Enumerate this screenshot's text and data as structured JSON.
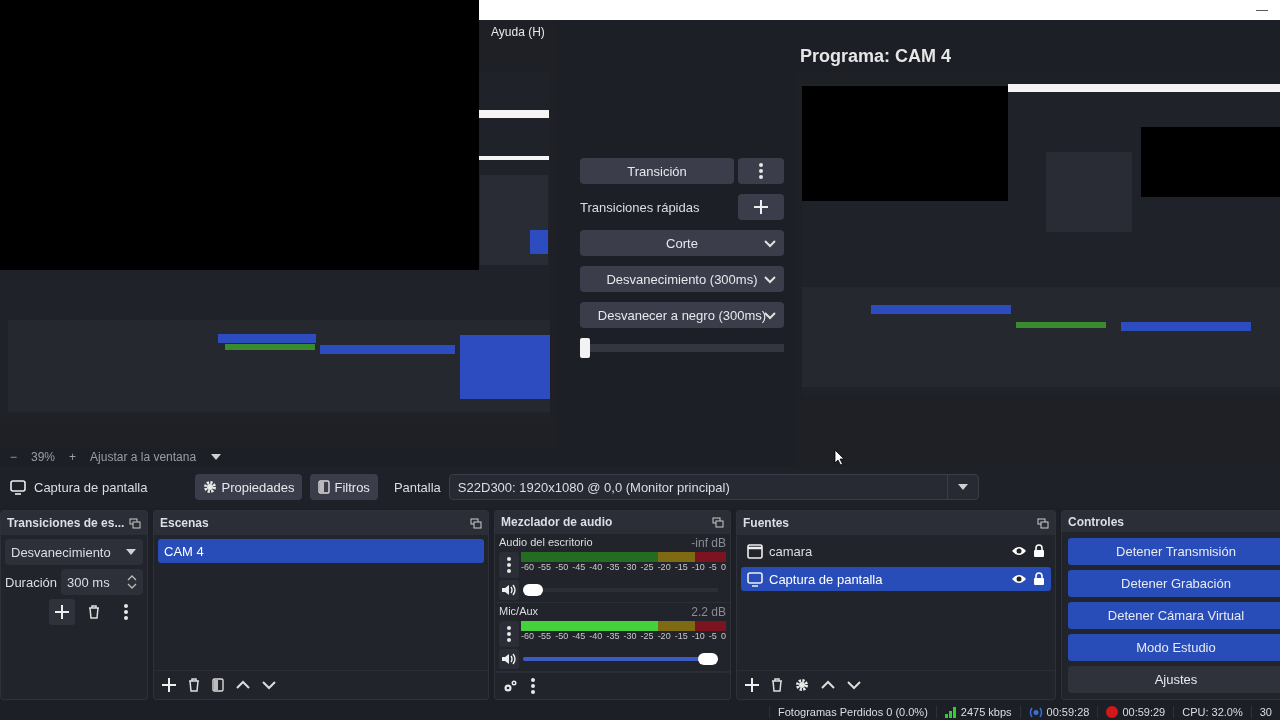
{
  "title_bar": {
    "minimize": "—"
  },
  "menu": [
    {
      "label": "Ayuda (H)"
    }
  ],
  "preview": {
    "kind": "picture",
    "zoom_out": "−",
    "zoom": "39%",
    "zoom_in": "+",
    "scale_mode": "Ajustar a la ventana"
  },
  "transition_panel": {
    "transition_button": "Transición",
    "quick_label": "Transiciones rápidas",
    "quick_transitions": [
      "Corte",
      "Desvanecimiento (300ms)",
      "Desvanecer a negro (300ms)"
    ],
    "tbar": {
      "level": 0
    }
  },
  "program": {
    "title": "Programa: CAM 4",
    "kind": "picture"
  },
  "source_toolbar": {
    "source_name": "Captura de pantalla",
    "properties": "Propiedades",
    "filters": "Filtros",
    "display_label": "Pantalla",
    "display_value": "S22D300: 1920x1080 @ 0,0 (Monitor principal)"
  },
  "transitions_dock": {
    "title": "Transiciones de es...",
    "transition": "Desvanecimiento",
    "duration_label": "Duración",
    "duration": "300 ms"
  },
  "scenes_dock": {
    "title": "Escenas",
    "items": [
      {
        "label": "CAM 4",
        "selected": true
      }
    ]
  },
  "mixer_dock": {
    "title": "Mezclador de audio",
    "channels": [
      {
        "name": "Audio del escritorio",
        "reading": "-inf dB",
        "meter": {
          "level": 0
        },
        "volume": {
          "level": 0
        },
        "scale": [
          "-60",
          "-55",
          "-50",
          "-45",
          "-40",
          "-35",
          "-30",
          "-25",
          "-20",
          "-15",
          "-10",
          "-5",
          "0"
        ]
      },
      {
        "name": "Mic/Aux",
        "reading": "2.2 dB",
        "meter": {
          "level": 0.67
        },
        "volume": {
          "level": 1
        },
        "scale": [
          "-60",
          "-55",
          "-50",
          "-45",
          "-40",
          "-35",
          "-30",
          "-25",
          "-20",
          "-15",
          "-10",
          "-5",
          "0"
        ]
      }
    ]
  },
  "sources_dock": {
    "title": "Fuentes",
    "items": [
      {
        "kind": "window",
        "label": "camara",
        "selected": false,
        "visible": true,
        "locked": true
      },
      {
        "kind": "display",
        "label": "Captura de pantalla",
        "selected": true,
        "visible": true,
        "locked": true
      }
    ]
  },
  "controls_dock": {
    "title": "Controles",
    "buttons": [
      {
        "label": "Detener Transmisión",
        "active": true
      },
      {
        "label": "Detener Grabación",
        "active": true
      },
      {
        "label": "Detener Cámara Virtual",
        "active": true
      },
      {
        "label": "Modo Estudio",
        "active": true
      },
      {
        "label": "Ajustes",
        "active": false
      }
    ]
  },
  "status_bar": {
    "dropped_frames": "Fotogramas Perdidos 0 (0.0%)",
    "bitrate": "2475 kbps",
    "stream_time": "00:59:28",
    "record_time": "00:59:29",
    "cpu": "CPU: 32.0%",
    "fps": "30"
  }
}
